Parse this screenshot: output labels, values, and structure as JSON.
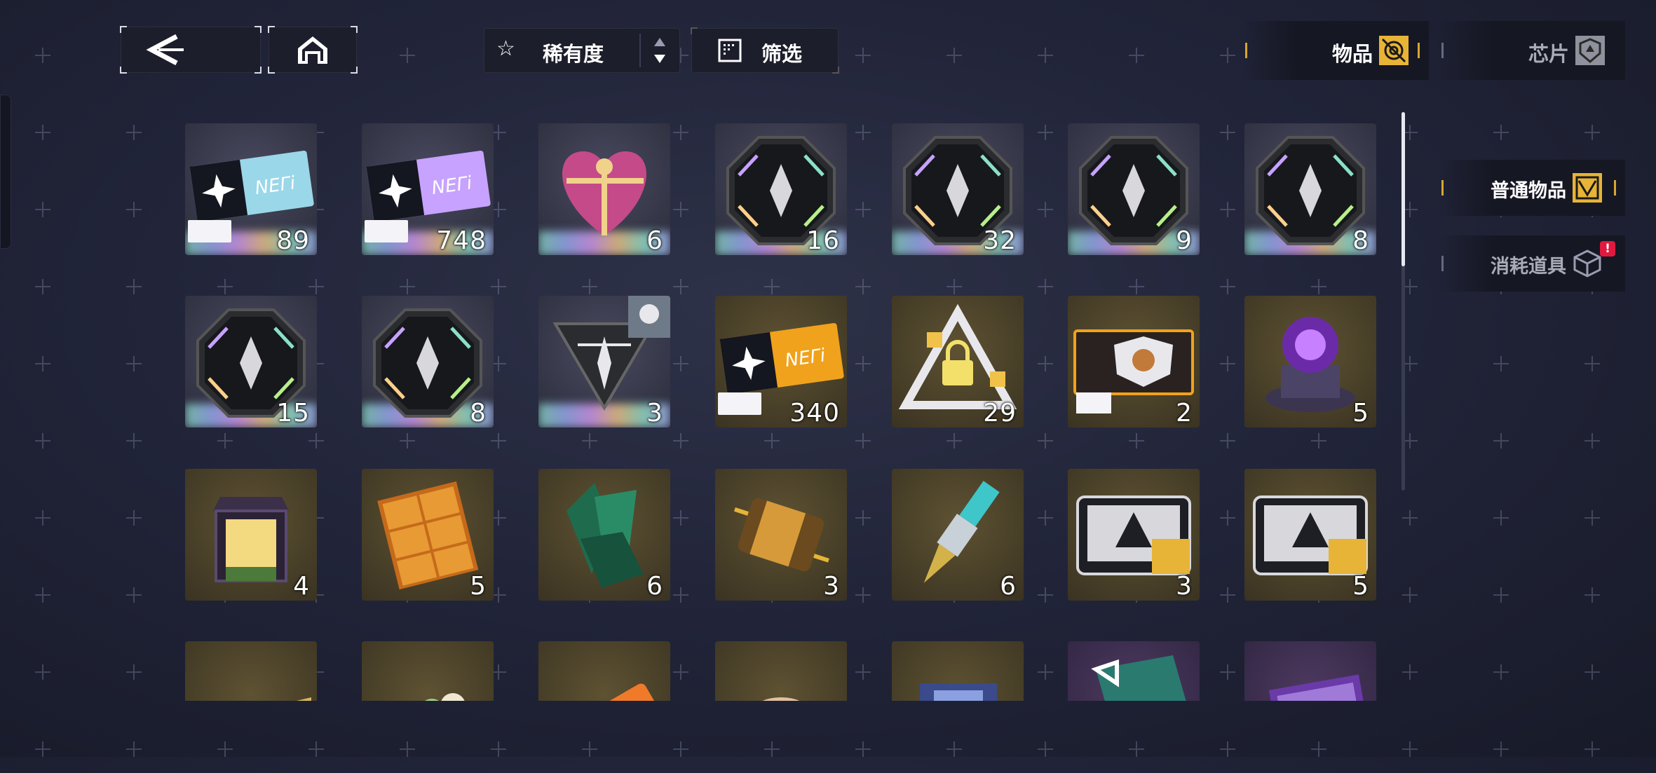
{
  "toolbar": {
    "back_label": "<",
    "sort_label": "稀有度",
    "filter_label": "筛选"
  },
  "top_tabs": [
    {
      "label": "物品",
      "icon": "item-icon",
      "active": true
    },
    {
      "label": "芯片",
      "icon": "chip-icon",
      "active": false
    }
  ],
  "side_tabs": [
    {
      "label": "普通物品",
      "icon": "common-item-icon",
      "active": true,
      "alert": ""
    },
    {
      "label": "消耗道具",
      "icon": "consumable-icon",
      "active": false,
      "alert": "!"
    }
  ],
  "colors": {
    "accent": "#e8b437",
    "panel": "#1c1e2b",
    "rare_gold": "#e8b437"
  },
  "grid_rows": [
    [
      {
        "name": "ticket-white",
        "icon": "ticket-icon",
        "count": "89",
        "rarity": "ssr"
      },
      {
        "name": "ticket-purple",
        "icon": "ticket-icon",
        "count": "748",
        "rarity": "ssr"
      },
      {
        "name": "heart-gift",
        "icon": "heart-gift-icon",
        "count": "6",
        "rarity": "ssr"
      },
      {
        "name": "core-module-1",
        "icon": "octagon-emblem-icon",
        "count": "16",
        "rarity": "ssr"
      },
      {
        "name": "core-module-2",
        "icon": "octagon-emblem-icon",
        "count": "32",
        "rarity": "ssr"
      },
      {
        "name": "core-module-3",
        "icon": "octagon-emblem-icon",
        "count": "9",
        "rarity": "ssr"
      },
      {
        "name": "core-module-4",
        "icon": "octagon-emblem-icon",
        "count": "8",
        "rarity": "ssr"
      }
    ],
    [
      {
        "name": "core-module-5",
        "icon": "octagon-emblem-icon",
        "count": "15",
        "rarity": "ssr"
      },
      {
        "name": "core-module-6",
        "icon": "octagon-emblem-icon",
        "count": "8",
        "rarity": "ssr"
      },
      {
        "name": "triangle-module",
        "icon": "triangle-emblem-icon",
        "count": "3",
        "rarity": "ssr"
      },
      {
        "name": "ticket-gold",
        "icon": "ticket-icon",
        "count": "340",
        "rarity": "sr"
      },
      {
        "name": "lock-triangle",
        "icon": "lock-triangle-icon",
        "count": "29",
        "rarity": "sr"
      },
      {
        "name": "shield-ticket",
        "icon": "shield-ticket-icon",
        "count": "2",
        "rarity": "sr"
      },
      {
        "name": "purple-orb",
        "icon": "orb-icon",
        "count": "5",
        "rarity": "sr"
      }
    ],
    [
      {
        "name": "lantern",
        "icon": "lantern-icon",
        "count": "4",
        "rarity": "sr"
      },
      {
        "name": "gold-bricks",
        "icon": "brick-icon",
        "count": "5",
        "rarity": "sr"
      },
      {
        "name": "green-crystal",
        "icon": "crystal-icon",
        "count": "6",
        "rarity": "sr"
      },
      {
        "name": "chip-capsule",
        "icon": "capsule-icon",
        "count": "3",
        "rarity": "sr"
      },
      {
        "name": "cyan-drill",
        "icon": "drill-icon",
        "count": "6",
        "rarity": "sr"
      },
      {
        "name": "gear-case-1",
        "icon": "case-icon",
        "count": "3",
        "rarity": "sr"
      },
      {
        "name": "gear-case-2",
        "icon": "case-icon",
        "count": "5",
        "rarity": "sr"
      }
    ],
    [
      {
        "name": "gold-blade",
        "icon": "blade-icon",
        "count": "",
        "rarity": "sr"
      },
      {
        "name": "dango",
        "icon": "food-icon",
        "count": "",
        "rarity": "sr"
      },
      {
        "name": "orange-tool",
        "icon": "tool-icon",
        "count": "",
        "rarity": "sr"
      },
      {
        "name": "cake",
        "icon": "cake-icon",
        "count": "",
        "rarity": "sr"
      },
      {
        "name": "game-box",
        "icon": "box-icon",
        "count": "",
        "rarity": "sr"
      },
      {
        "name": "teal-emblem",
        "icon": "emblem-icon",
        "count": "",
        "rarity": "r"
      },
      {
        "name": "purple-card",
        "icon": "card-icon",
        "count": "",
        "rarity": "r"
      }
    ]
  ]
}
